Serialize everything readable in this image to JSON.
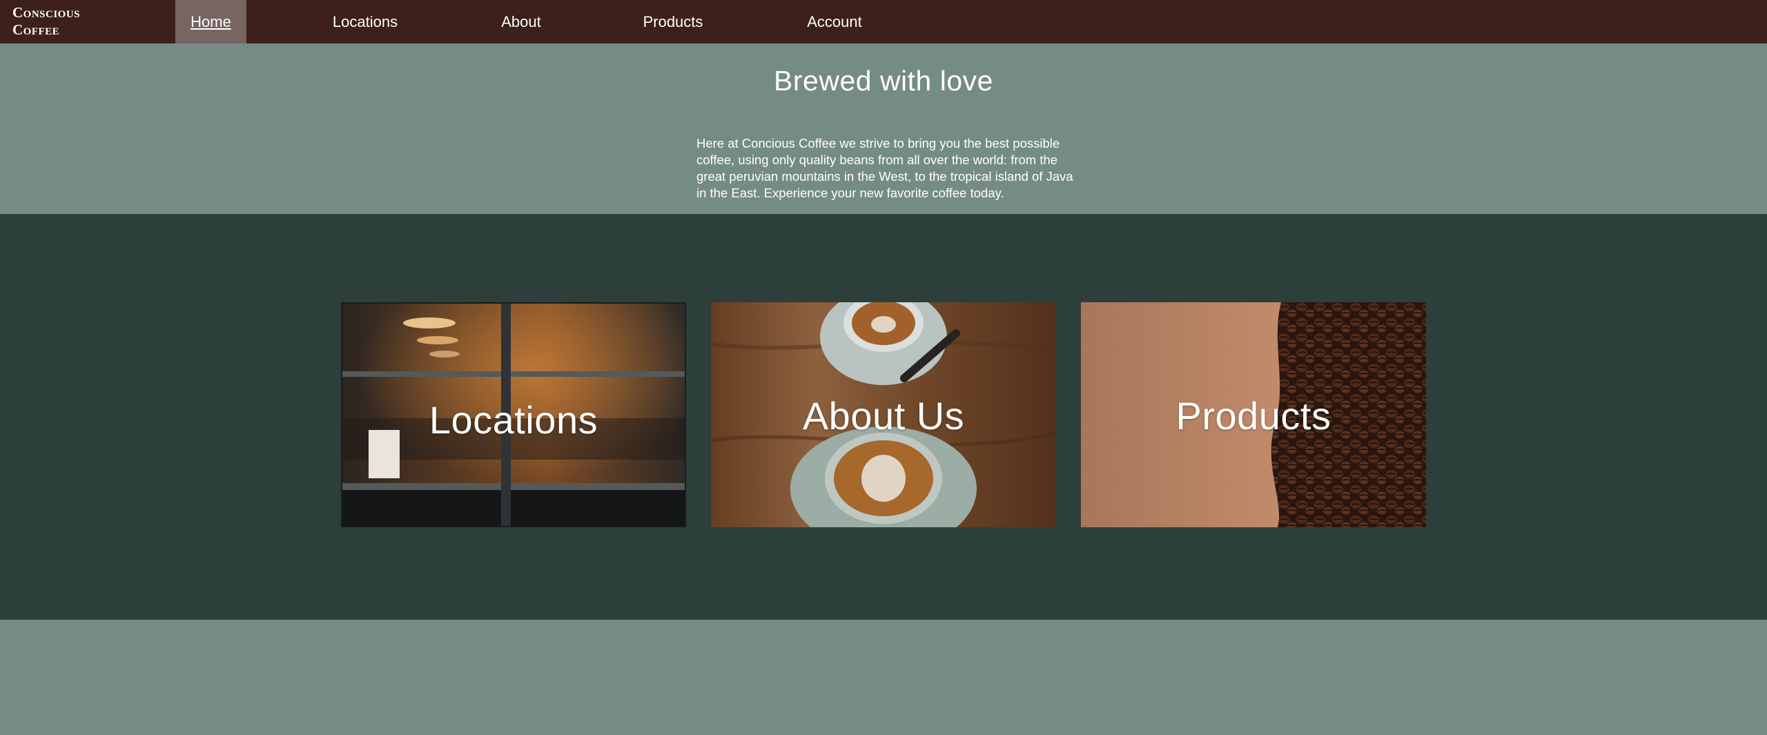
{
  "brand": {
    "line1": "Conscious",
    "line2": "Coffee"
  },
  "nav": {
    "items": [
      {
        "label": "Home",
        "active": true
      },
      {
        "label": "Locations"
      },
      {
        "label": "About"
      },
      {
        "label": "Products"
      },
      {
        "label": "Account"
      }
    ]
  },
  "hero": {
    "title": "Brewed with love",
    "text": "Here at Concious Coffee we strive to bring you the best possible coffee, using only quality beans from all over the world: from the great peruvian mountains in the West, to the tropical island of Java in the East. Experience your new favorite coffee today."
  },
  "cards": [
    {
      "label": "Locations",
      "image": "cafe-window-photo"
    },
    {
      "label": "About Us",
      "image": "latte-cups-photo"
    },
    {
      "label": "Products",
      "image": "coffee-beans-photo"
    }
  ],
  "colors": {
    "nav_bg": "#3c2019",
    "nav_active": "#766561",
    "page_bg": "#758b86",
    "band_bg": "#2d3f3b"
  }
}
